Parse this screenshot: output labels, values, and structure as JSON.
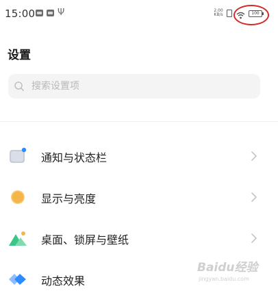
{
  "status_bar": {
    "time": "15:00",
    "net_speed": "2.00 KB/s",
    "battery": "100",
    "usb_symbol": "Ψ",
    "highlight_color": "#d32a2a"
  },
  "header": {
    "title": "设置"
  },
  "search": {
    "placeholder": "搜索设置项"
  },
  "settings": {
    "items": [
      {
        "label": "通知与状态栏",
        "icon": "notification-icon"
      },
      {
        "label": "显示与亮度",
        "icon": "brightness-icon"
      },
      {
        "label": "桌面、锁屏与壁纸",
        "icon": "wallpaper-icon"
      },
      {
        "label": "动态效果",
        "icon": "animation-icon"
      }
    ]
  },
  "watermark": {
    "text": "Baidu经验",
    "url": "jingyan.baidu.com"
  },
  "colors": {
    "accent_blue": "#2b8cff",
    "sun_orange": "#f5b54a",
    "landscape_green": "#3cc58a"
  }
}
